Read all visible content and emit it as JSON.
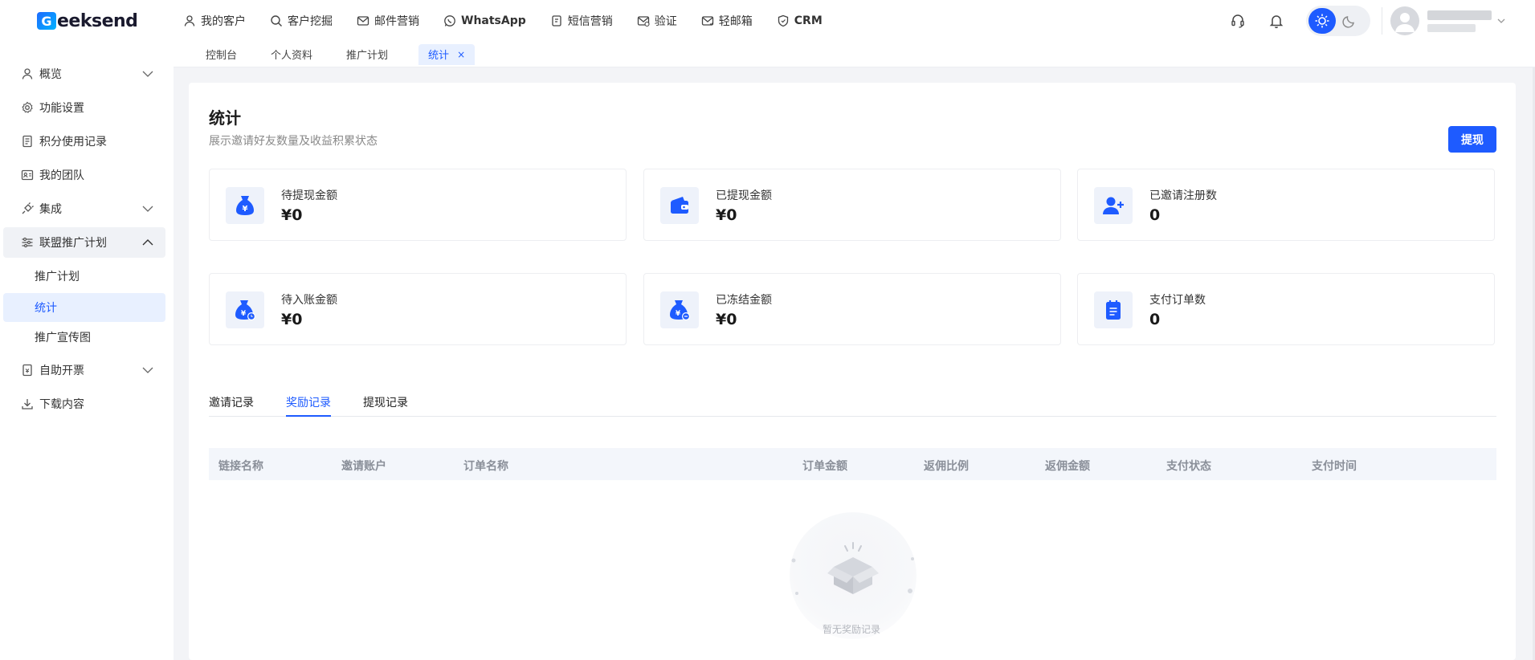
{
  "brand": {
    "name": "eeksend",
    "logo_letter": "G",
    "logo_color": "#1e5bff"
  },
  "topnav": [
    {
      "label": "我的客户",
      "icon": "user-icon"
    },
    {
      "label": "客户挖掘",
      "icon": "search-icon"
    },
    {
      "label": "邮件营销",
      "icon": "mail-icon"
    },
    {
      "label": "WhatsApp",
      "icon": "whatsapp-icon"
    },
    {
      "label": "短信营销",
      "icon": "sms-icon"
    },
    {
      "label": "验证",
      "icon": "verify-icon"
    },
    {
      "label": "轻邮箱",
      "icon": "light-mail-icon"
    },
    {
      "label": "CRM",
      "icon": "crm-icon"
    }
  ],
  "tabs": [
    {
      "label": "控制台"
    },
    {
      "label": "个人资料"
    },
    {
      "label": "推广计划"
    },
    {
      "label": "统计",
      "close": "×"
    }
  ],
  "sidebar": {
    "items": [
      {
        "label": "概览",
        "icon": "user-icon"
      },
      {
        "label": "功能设置",
        "icon": "gear-icon"
      },
      {
        "label": "积分使用记录",
        "icon": "document-icon"
      },
      {
        "label": "我的团队",
        "icon": "id-card-icon"
      },
      {
        "label": "集成",
        "icon": "plug-icon"
      },
      {
        "label": "联盟推广计划",
        "icon": "sliders-icon"
      },
      {
        "label": "自助开票",
        "icon": "invoice-icon"
      },
      {
        "label": "下载内容",
        "icon": "download-icon"
      }
    ],
    "sub_items": [
      {
        "label": "推广计划"
      },
      {
        "label": "统计"
      },
      {
        "label": "推广宣传图"
      }
    ]
  },
  "page": {
    "title": "统计",
    "subtitle": "展示邀请好友数量及收益积累状态",
    "withdraw_label": "提现"
  },
  "stats": [
    {
      "label": "待提现金额",
      "value": "¥0",
      "icon": "money-bag-icon"
    },
    {
      "label": "已提现金额",
      "value": "¥0",
      "icon": "wallet-icon"
    },
    {
      "label": "已邀请注册数",
      "value": "0",
      "icon": "add-user-icon"
    },
    {
      "label": "待入账金额",
      "value": "¥0",
      "icon": "money-bag-clock-icon"
    },
    {
      "label": "已冻结金额",
      "value": "¥0",
      "icon": "money-bag-frozen-icon"
    },
    {
      "label": "支付订单数",
      "value": "0",
      "icon": "clipboard-icon"
    }
  ],
  "record_tabs": [
    {
      "label": "邀请记录"
    },
    {
      "label": "奖励记录"
    },
    {
      "label": "提现记录"
    }
  ],
  "table": {
    "columns": [
      "链接名称",
      "邀请账户",
      "订单名称",
      "订单金额",
      "返佣比例",
      "返佣金额",
      "支付状态",
      "支付时间"
    ],
    "empty_text": "暂无奖励记录"
  },
  "colors": {
    "accent": "#1e5bff",
    "page_bg": "#f3f4f7",
    "icon_bg": "#eef2fa"
  }
}
